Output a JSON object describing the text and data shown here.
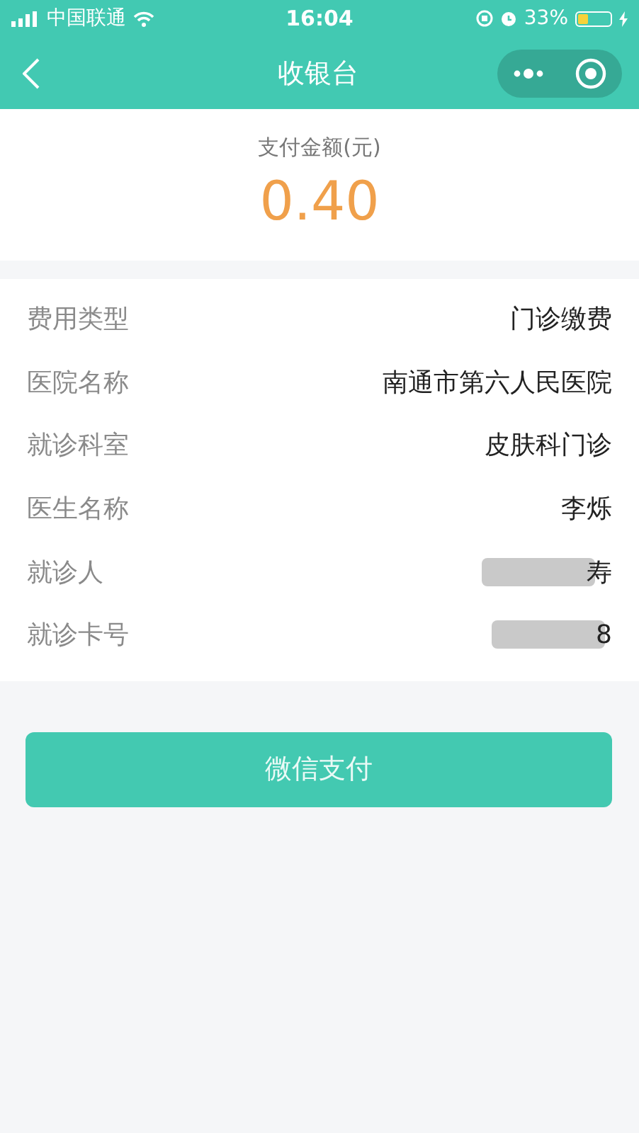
{
  "status_bar": {
    "carrier": "中国联通",
    "time": "16:04",
    "battery": "33%"
  },
  "nav": {
    "title": "收银台"
  },
  "amount": {
    "label": "支付金额(元)",
    "value": "0.40"
  },
  "rows": [
    {
      "label": "费用类型",
      "value": "门诊缴费",
      "redacted": false
    },
    {
      "label": "医院名称",
      "value": "南通市第六人民医院",
      "redacted": false
    },
    {
      "label": "就诊科室",
      "value": "皮肤科门诊",
      "redacted": false
    },
    {
      "label": "医生名称",
      "value": "李烁",
      "redacted": false
    },
    {
      "label": "就诊人",
      "value": "寿",
      "redacted": true
    },
    {
      "label": "就诊卡号",
      "value": "8",
      "redacted": true
    }
  ],
  "pay_button": {
    "label": "微信支付"
  }
}
